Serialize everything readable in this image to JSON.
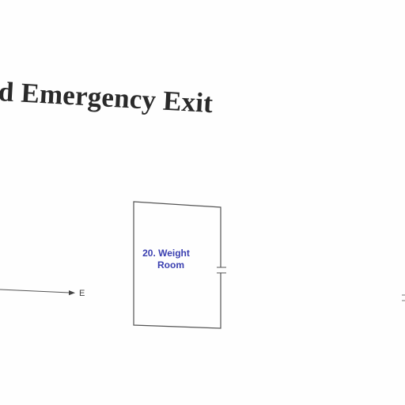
{
  "title": "d Emergency Exit",
  "room": {
    "number_name_line1": "20. Weight",
    "name_line2": "Room"
  },
  "exit_marker": "E",
  "colors": {
    "title": "#2a2a2a",
    "room_label": "#3a3fb0",
    "lines": "#555555"
  }
}
